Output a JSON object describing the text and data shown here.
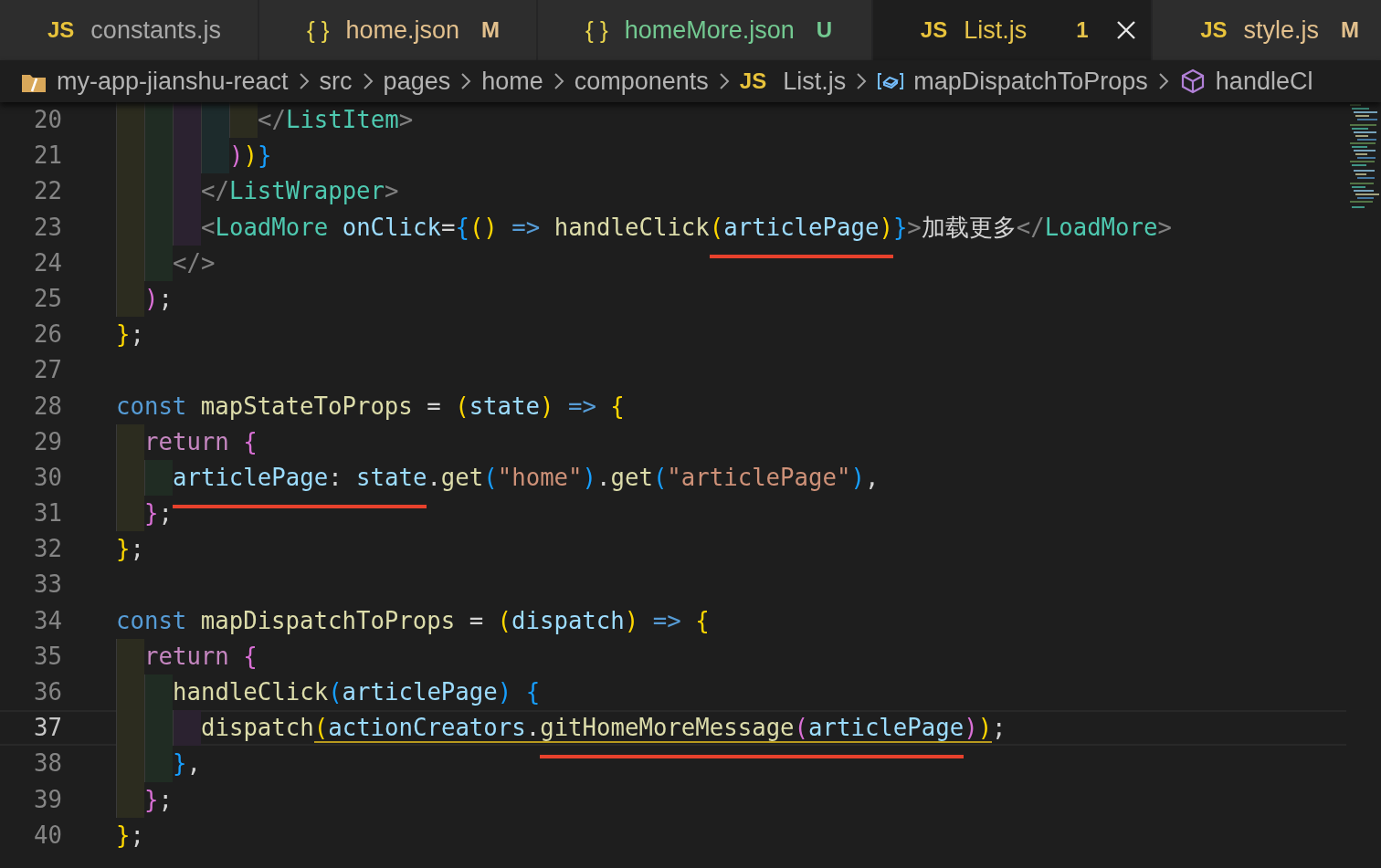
{
  "tabs": [
    {
      "icon": "JS",
      "kind": "js",
      "label": "constants.js",
      "color": "#a8a8a8",
      "selected": false
    },
    {
      "icon": "{ }",
      "kind": "json",
      "label": "home.json",
      "color": "#e2c08d",
      "badge": "M",
      "selected": false
    },
    {
      "icon": "{ }",
      "kind": "json",
      "label": "homeMore.json",
      "color": "#73c991",
      "badge": "U",
      "selected": false
    },
    {
      "icon": "JS",
      "kind": "js",
      "label": "List.js",
      "color": "#e5c34a",
      "badge": "1",
      "selected": true
    },
    {
      "icon": "JS",
      "kind": "js",
      "label": "style.js",
      "color": "#e2c08d",
      "badge": "M",
      "selected": false
    }
  ],
  "breadcrumbs": [
    {
      "kind": "folder",
      "label": "my-app-jianshu-react"
    },
    {
      "kind": "plain",
      "label": "src"
    },
    {
      "kind": "plain",
      "label": "pages"
    },
    {
      "kind": "plain",
      "label": "home"
    },
    {
      "kind": "plain",
      "label": "components"
    },
    {
      "kind": "file",
      "icon": "JS",
      "label": "List.js"
    },
    {
      "kind": "variable",
      "label": "mapDispatchToProps"
    },
    {
      "kind": "method",
      "label": "handleCl"
    }
  ],
  "lines": [
    {
      "number": "20",
      "current": false,
      "tokens": [
        {
          "kind": "punct",
          "text": "          </"
        },
        {
          "kind": "tag",
          "text": "ListItem"
        },
        {
          "kind": "punct",
          "text": ">"
        }
      ]
    },
    {
      "number": "21",
      "current": false,
      "tokens": [
        {
          "kind": "bracket2",
          "text": "        )"
        },
        {
          "kind": "bracket1",
          "text": ")"
        },
        {
          "kind": "bracket3",
          "text": "}"
        }
      ]
    },
    {
      "number": "22",
      "current": false,
      "tokens": [
        {
          "kind": "punct",
          "text": "      </"
        },
        {
          "kind": "tag",
          "text": "ListWrapper"
        },
        {
          "kind": "punct",
          "text": ">"
        }
      ]
    },
    {
      "number": "23",
      "current": false,
      "tokens": [
        {
          "kind": "punct",
          "text": "      <"
        },
        {
          "kind": "tag",
          "text": "LoadMore"
        },
        {
          "kind": "attr",
          "text": " onClick"
        },
        {
          "kind": "plain",
          "text": "="
        },
        {
          "kind": "bracket3",
          "text": "{"
        },
        {
          "kind": "bracket1",
          "text": "()"
        },
        {
          "kind": "keyword",
          "text": " => "
        },
        {
          "kind": "function",
          "text": "handleClick"
        },
        {
          "kind": "bracket1",
          "text": "(",
          "marked": true
        },
        {
          "kind": "variable",
          "text": "articlePage",
          "marked": true
        },
        {
          "kind": "bracket1",
          "text": ")",
          "marked": true
        },
        {
          "kind": "bracket3",
          "text": "}"
        },
        {
          "kind": "punct",
          "text": ">"
        },
        {
          "kind": "plain",
          "text": "加载更多"
        },
        {
          "kind": "punct",
          "text": "</"
        },
        {
          "kind": "tag",
          "text": "LoadMore"
        },
        {
          "kind": "punct",
          "text": ">"
        }
      ]
    },
    {
      "number": "24",
      "current": false,
      "tokens": [
        {
          "kind": "punct",
          "text": "    </>"
        }
      ]
    },
    {
      "number": "25",
      "current": false,
      "tokens": [
        {
          "kind": "bracket2",
          "text": "  )"
        },
        {
          "kind": "plain",
          "text": ";"
        }
      ]
    },
    {
      "number": "26",
      "current": false,
      "tokens": [
        {
          "kind": "bracket1",
          "text": "}"
        },
        {
          "kind": "plain",
          "text": ";"
        }
      ]
    },
    {
      "number": "27",
      "current": false
    },
    {
      "number": "28",
      "current": false,
      "tokens": [
        {
          "kind": "keyword",
          "text": "const "
        },
        {
          "kind": "function",
          "text": "mapStateToProps"
        },
        {
          "kind": "plain",
          "text": " = "
        },
        {
          "kind": "bracket1",
          "text": "("
        },
        {
          "kind": "variable",
          "text": "state"
        },
        {
          "kind": "bracket1",
          "text": ")"
        },
        {
          "kind": "keyword",
          "text": " => "
        },
        {
          "kind": "bracket1",
          "text": "{"
        }
      ]
    },
    {
      "number": "29",
      "current": false,
      "tokens": [
        {
          "kind": "control",
          "text": "  return "
        },
        {
          "kind": "bracket2",
          "text": "{"
        }
      ]
    },
    {
      "number": "30",
      "current": false,
      "tokens": [
        {
          "kind": "variable",
          "text": "    articlePage",
          "marked": true
        },
        {
          "kind": "plain",
          "text": ": ",
          "marked": true
        },
        {
          "kind": "variable",
          "text": "state",
          "marked": true
        },
        {
          "kind": "plain",
          "text": "."
        },
        {
          "kind": "function",
          "text": "get"
        },
        {
          "kind": "bracket3",
          "text": "("
        },
        {
          "kind": "string",
          "text": "\"home\""
        },
        {
          "kind": "bracket3",
          "text": ")"
        },
        {
          "kind": "plain",
          "text": "."
        },
        {
          "kind": "function",
          "text": "get"
        },
        {
          "kind": "bracket3",
          "text": "("
        },
        {
          "kind": "string",
          "text": "\"articlePage\""
        },
        {
          "kind": "bracket3",
          "text": ")"
        },
        {
          "kind": "plain",
          "text": ","
        }
      ]
    },
    {
      "number": "31",
      "current": false,
      "tokens": [
        {
          "kind": "bracket2",
          "text": "  }"
        },
        {
          "kind": "plain",
          "text": ";"
        }
      ]
    },
    {
      "number": "32",
      "current": false,
      "tokens": [
        {
          "kind": "bracket1",
          "text": "}"
        },
        {
          "kind": "plain",
          "text": ";"
        }
      ]
    },
    {
      "number": "33",
      "current": false
    },
    {
      "number": "34",
      "current": false,
      "tokens": [
        {
          "kind": "keyword",
          "text": "const "
        },
        {
          "kind": "function",
          "text": "mapDispatchToProps"
        },
        {
          "kind": "plain",
          "text": " = "
        },
        {
          "kind": "bracket1",
          "text": "("
        },
        {
          "kind": "variable",
          "text": "dispatch"
        },
        {
          "kind": "bracket1",
          "text": ")"
        },
        {
          "kind": "keyword",
          "text": " => "
        },
        {
          "kind": "bracket1",
          "text": "{"
        }
      ]
    },
    {
      "number": "35",
      "current": false,
      "tokens": [
        {
          "kind": "control",
          "text": "  return "
        },
        {
          "kind": "bracket2",
          "text": "{"
        }
      ]
    },
    {
      "number": "36",
      "current": false,
      "tokens": [
        {
          "kind": "function",
          "text": "    handleClick"
        },
        {
          "kind": "bracket3",
          "text": "("
        },
        {
          "kind": "variable",
          "text": "articlePage"
        },
        {
          "kind": "bracket3",
          "text": ")"
        },
        {
          "kind": "bracket3",
          "text": " {"
        }
      ]
    },
    {
      "number": "37",
      "current": true,
      "tokens": [
        {
          "kind": "function",
          "text": "      dispatch"
        },
        {
          "kind": "bracket1",
          "text": "(",
          "warning": true
        },
        {
          "kind": "variable",
          "text": "actionCreators",
          "warning": true
        },
        {
          "kind": "plain",
          "text": ".",
          "warning": true
        },
        {
          "kind": "function",
          "text": "gitHomeMoreMessage",
          "warning": true,
          "marked": true
        },
        {
          "kind": "bracket2",
          "text": "(",
          "warning": true,
          "marked": true
        },
        {
          "kind": "variable",
          "text": "articlePage",
          "warning": true,
          "marked": true
        },
        {
          "kind": "bracket2",
          "text": ")",
          "warning": true
        },
        {
          "kind": "bracket1",
          "text": ")",
          "warning": true
        },
        {
          "kind": "plain",
          "text": ";"
        }
      ]
    },
    {
      "number": "38",
      "current": false,
      "tokens": [
        {
          "kind": "bracket3",
          "text": "    }"
        },
        {
          "kind": "plain",
          "text": ","
        }
      ]
    },
    {
      "number": "39",
      "current": false,
      "tokens": [
        {
          "kind": "bracket2",
          "text": "  }"
        },
        {
          "kind": "plain",
          "text": ";"
        }
      ]
    },
    {
      "number": "40",
      "current": false,
      "tokens": [
        {
          "kind": "bracket1",
          "text": "}"
        },
        {
          "kind": "plain",
          "text": ";"
        }
      ]
    }
  ]
}
